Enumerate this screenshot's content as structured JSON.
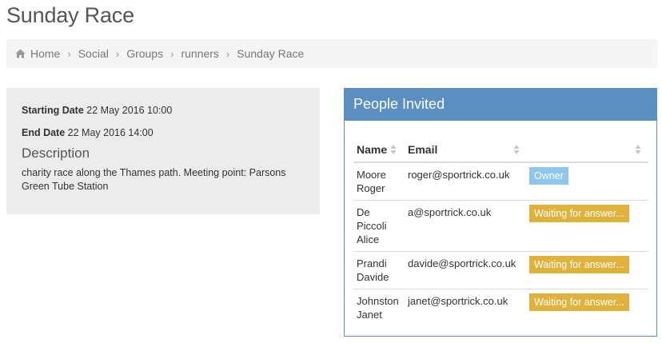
{
  "page": {
    "title": "Sunday Race"
  },
  "breadcrumb": [
    "Home",
    "Social",
    "Groups",
    "runners",
    "Sunday Race"
  ],
  "event": {
    "start_label": "Starting Date",
    "start_value": "22 May 2016 10:00",
    "end_label": "End Date",
    "end_value": "22 May 2016 14:00",
    "description_heading": "Description",
    "description_text": "charity race along the Thames path. Meeting point: Parsons Green Tube Station"
  },
  "invited": {
    "title": "People Invited",
    "columns": [
      "Name",
      "Email",
      ""
    ],
    "rows": [
      {
        "name": "Moore Roger",
        "email": "roger@sportrick.co.uk",
        "status": "Owner",
        "status_type": "owner"
      },
      {
        "name": "De Piccoli Alice",
        "email": "a@sportrick.co.uk",
        "status": "Waiting for answer...",
        "status_type": "waiting"
      },
      {
        "name": "Prandi Davide",
        "email": "davide@sportrick.co.uk",
        "status": "Waiting for answer...",
        "status_type": "waiting"
      },
      {
        "name": "Johnston Janet",
        "email": "janet@sportrick.co.uk",
        "status": "Waiting for answer...",
        "status_type": "waiting"
      }
    ]
  },
  "colors": {
    "panel_primary": "#5b8fc1",
    "label_owner": "#8fc6ee",
    "label_waiting": "#e0b13b",
    "breadcrumb_bg": "#f5f5f5",
    "details_bg": "#ececec"
  },
  "icons": {
    "breadcrumb_home": "home-icon",
    "table_sort": "sort-icon"
  }
}
